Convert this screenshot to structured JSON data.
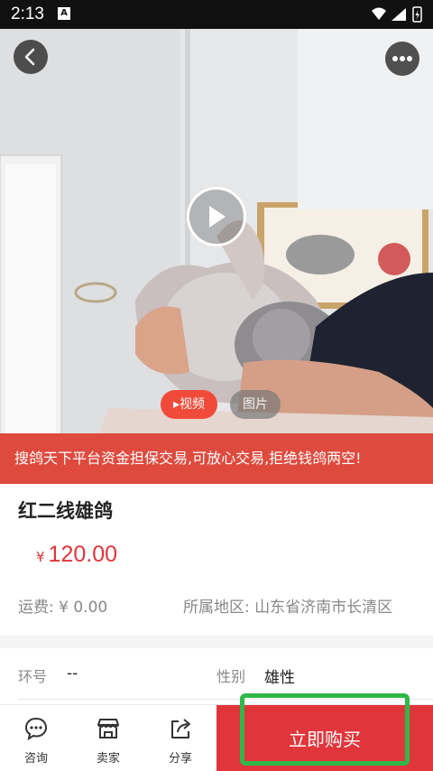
{
  "status_bar": {
    "time": "2:13",
    "badge": "A"
  },
  "media": {
    "tabs": [
      {
        "label": "视频",
        "active": true
      },
      {
        "label": "图片",
        "active": false
      }
    ]
  },
  "banner": {
    "text": "搜鸽天下平台资金担保交易,可放心交易,拒绝钱鸽两空!"
  },
  "product": {
    "title": "红二线雄鸽",
    "price_symbol": "¥",
    "price": "120.00",
    "shipping": "运费: ¥ 0.00",
    "region": "所属地区: 山东省济南市长清区"
  },
  "specs": {
    "ring_label": "环号",
    "ring_value": "--",
    "gender_label": "性别",
    "gender_value": "雄性"
  },
  "bottom_bar": {
    "actions": [
      {
        "label": "咨询",
        "icon": "chat-icon"
      },
      {
        "label": "卖家",
        "icon": "shop-icon"
      },
      {
        "label": "分享",
        "icon": "share-icon"
      }
    ],
    "buy_label": "立即购买"
  },
  "colors": {
    "accent": "#e0353a",
    "banner": "#df4a3e",
    "highlight": "#2fb84a"
  }
}
